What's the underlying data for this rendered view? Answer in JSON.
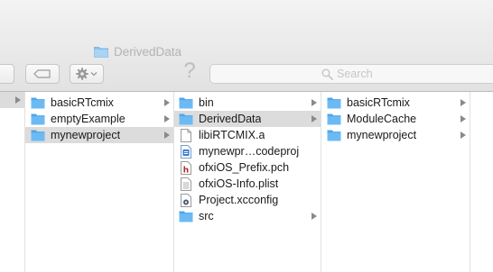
{
  "window": {
    "title": "DerivedData",
    "search_placeholder": "Search",
    "help_glyph": "?"
  },
  "columns": [
    {
      "items": [
        {
          "label": "basicRTcmix",
          "icon": "folder-icon",
          "has_children": true,
          "selected": false
        },
        {
          "label": "emptyExample",
          "icon": "folder-icon",
          "has_children": true,
          "selected": false
        },
        {
          "label": "mynewproject",
          "icon": "folder-icon",
          "has_children": true,
          "selected": true
        }
      ]
    },
    {
      "items": [
        {
          "label": "bin",
          "icon": "folder-icon",
          "has_children": true,
          "selected": false
        },
        {
          "label": "DerivedData",
          "icon": "folder-icon",
          "has_children": true,
          "selected": true
        },
        {
          "label": "libiRTCMIX.a",
          "icon": "document-icon",
          "has_children": false,
          "selected": false
        },
        {
          "label": "mynewpr…codeproj",
          "icon": "xcode-project-icon",
          "has_children": false,
          "selected": false
        },
        {
          "label": "ofxiOS_Prefix.pch",
          "icon": "header-file-icon",
          "has_children": false,
          "selected": false
        },
        {
          "label": "ofxiOS-Info.plist",
          "icon": "plist-file-icon",
          "has_children": false,
          "selected": false
        },
        {
          "label": "Project.xcconfig",
          "icon": "xcconfig-file-icon",
          "has_children": false,
          "selected": false
        },
        {
          "label": "src",
          "icon": "folder-icon",
          "has_children": true,
          "selected": false
        }
      ]
    },
    {
      "items": [
        {
          "label": "basicRTcmix",
          "icon": "folder-icon",
          "has_children": true,
          "selected": false
        },
        {
          "label": "ModuleCache",
          "icon": "folder-icon",
          "has_children": true,
          "selected": false
        },
        {
          "label": "mynewproject",
          "icon": "folder-icon",
          "has_children": true,
          "selected": false
        }
      ]
    }
  ],
  "colors": {
    "folder": "#5fb3f0",
    "selection": "#dcdcdc",
    "arrow": "#8a8a8a",
    "toolbar_bg": "#ececec"
  }
}
